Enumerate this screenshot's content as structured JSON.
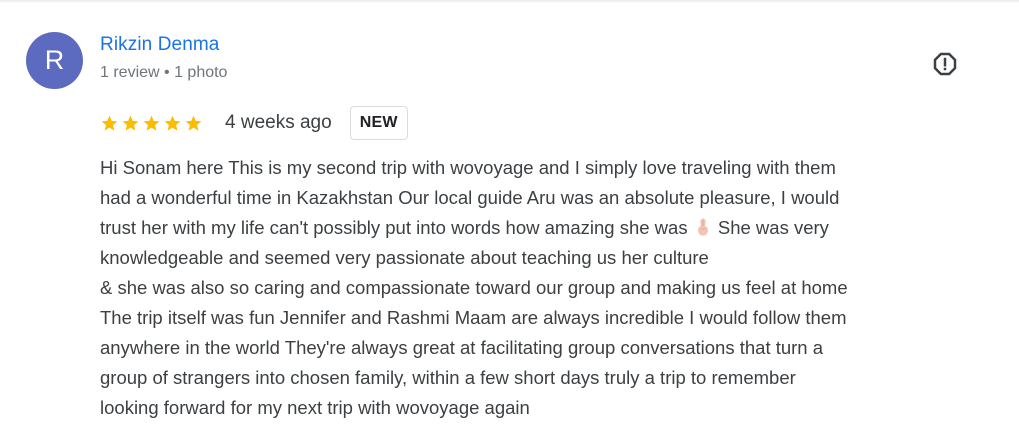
{
  "reviewer": {
    "avatar_letter": "R",
    "avatar_color": "#5c6bc0",
    "name": "Rikzin Denma",
    "meta": "1 review • 1 photo"
  },
  "rating": {
    "stars": 5,
    "max_stars": 5,
    "star_color": "#fbbc04",
    "time_ago": "4 weeks ago",
    "badge": "NEW"
  },
  "actions": {
    "report_icon": "report-icon"
  },
  "review": {
    "lines": [
      "Hi Sonam here This is my second trip with wovoyage and I simply love traveling with them",
      "had a wonderful time in Kazakhstan Our local guide Aru was an absolute pleasure, I would",
      "trust her with my life can't possibly put into words how amazing she was",
      "She was very",
      "knowledgeable and seemed very passionate about teaching us her culture",
      "& she was also so caring and compassionate toward our group and making us feel at home",
      "The trip itself was fun Jennifer and Rashmi Maam are always incredible I would follow them",
      "anywhere in the world They're always great at facilitating group conversations that turn a",
      "group of strangers into chosen family, within a few short days truly a trip to remember",
      "looking forward for my next trip with wovoyage again"
    ],
    "inline_emoji": "pinched-fingers-emoji"
  }
}
